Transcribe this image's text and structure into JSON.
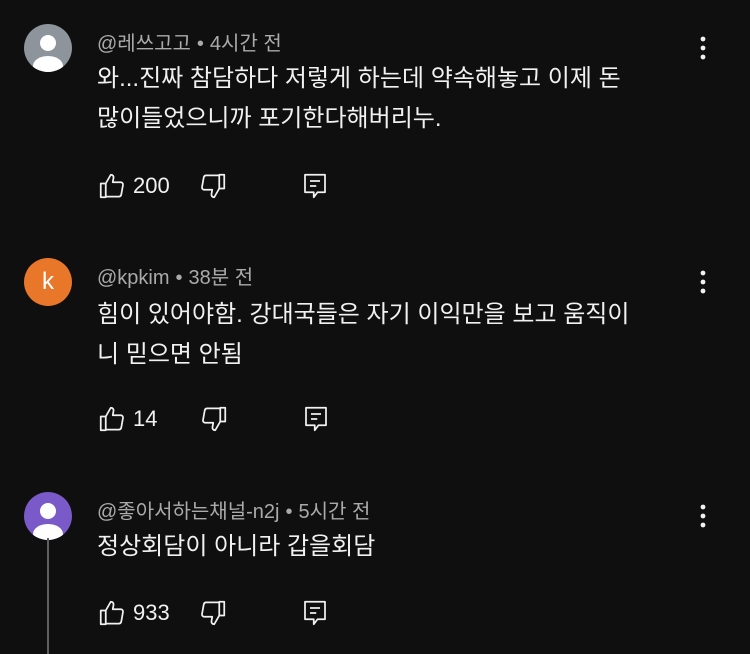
{
  "comments": [
    {
      "avatar_color": "#8e949c",
      "avatar_type": "person-silhouette",
      "author": "@레쓰고고",
      "time": "4시간 전",
      "lines": [
        "와...진짜 참담하다 저렇게 하는데 약속해놓고 이제 돈",
        "많이들었으니까 포기한다해버리누."
      ],
      "likes": "200"
    },
    {
      "avatar_color": "#e8772a",
      "avatar_letter": "k",
      "author": "@kpkim",
      "time": "38분 전",
      "lines": [
        "힘이 있어야함. 강대국들은 자기 이익만을 보고 움직이",
        "니 믿으면 안됨"
      ],
      "likes": "14"
    },
    {
      "avatar_color": "#7a5ac8",
      "avatar_type": "person-silhouette",
      "author": "@좋아서하는채널-n2j",
      "time": "5시간 전",
      "lines": [
        "정상회담이 아니라 갑을회담"
      ],
      "likes": "933"
    }
  ],
  "separator": "•",
  "icons": {
    "like": "thumbs-up-icon",
    "dislike": "thumbs-down-icon",
    "reply": "reply-icon",
    "more": "more-vertical-icon"
  }
}
